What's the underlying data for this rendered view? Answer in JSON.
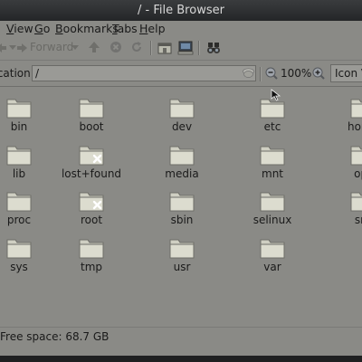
{
  "window": {
    "title": "/ - File Browser"
  },
  "menu": [
    {
      "label": "View",
      "mnemonic": "V",
      "rest": "iew"
    },
    {
      "label": "Go",
      "mnemonic": "G",
      "rest": "o"
    },
    {
      "label": "Bookmarks",
      "mnemonic": "B",
      "rest": "ookmarks"
    },
    {
      "label": "Tabs",
      "mnemonic": "T",
      "rest": "abs"
    },
    {
      "label": "Help",
      "mnemonic": "H",
      "rest": "elp"
    }
  ],
  "toolbar": {
    "forward_label": "Forward",
    "icons": [
      "back-arrow-icon",
      "forward-arrow-icon",
      "up-arrow-icon",
      "stop-icon",
      "reload-icon",
      "home-icon",
      "computer-icon",
      "search-icon"
    ]
  },
  "location": {
    "label": "Location:",
    "value": "/",
    "zoom": "100%",
    "view_mode": "Icon View"
  },
  "files": [
    {
      "name": "bin",
      "locked": false
    },
    {
      "name": "boot",
      "locked": false
    },
    {
      "name": "dev",
      "locked": false
    },
    {
      "name": "etc",
      "locked": false
    },
    {
      "name": "home",
      "locked": false
    },
    {
      "name": "lib",
      "locked": false
    },
    {
      "name": "lost+found",
      "locked": true
    },
    {
      "name": "media",
      "locked": false
    },
    {
      "name": "mnt",
      "locked": false
    },
    {
      "name": "opt",
      "locked": false
    },
    {
      "name": "proc",
      "locked": false
    },
    {
      "name": "root",
      "locked": true
    },
    {
      "name": "sbin",
      "locked": false
    },
    {
      "name": "selinux",
      "locked": false
    },
    {
      "name": "srv",
      "locked": false
    },
    {
      "name": "sys",
      "locked": false
    },
    {
      "name": "tmp",
      "locked": false
    },
    {
      "name": "usr",
      "locked": false
    },
    {
      "name": "var",
      "locked": false
    }
  ],
  "status": {
    "text": "Free space: 68.7 GB"
  },
  "colors": {
    "background": "#8a8a86",
    "titlebar": "#2e3032",
    "folder": "#cfcfc2"
  }
}
